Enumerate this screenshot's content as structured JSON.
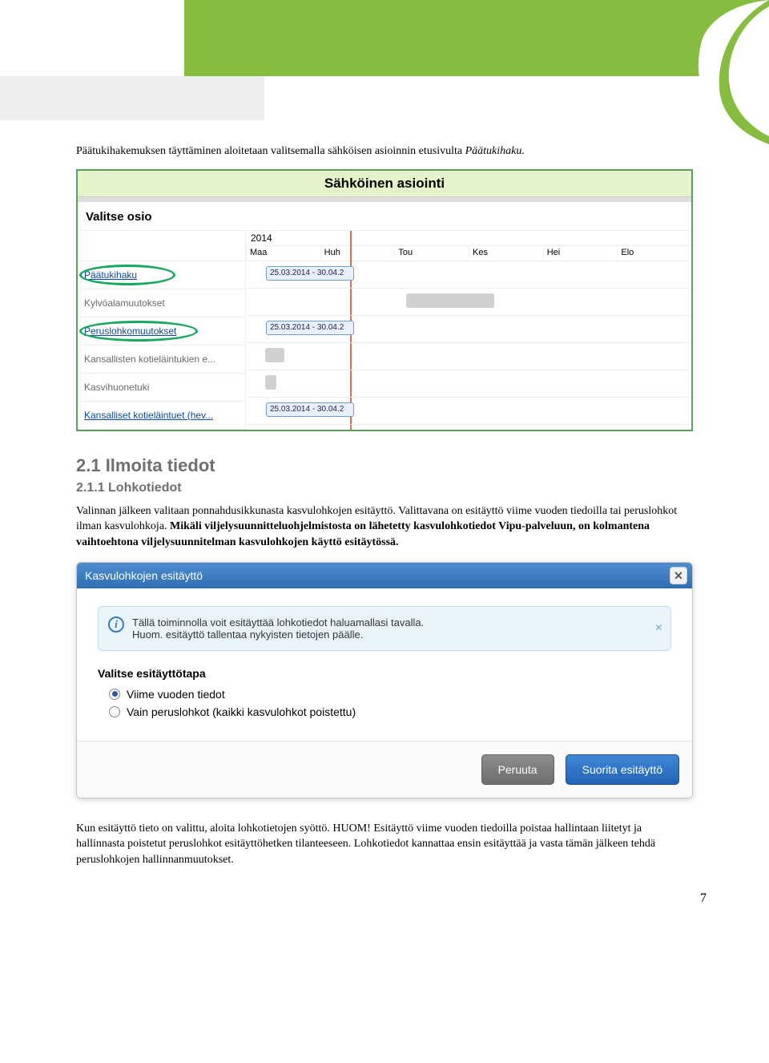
{
  "intro": "Päätukihakemuksen täyttäminen aloitetaan valitsemalla sähköisen asioinnin etusivulta ",
  "intro_em": "Päätukihaku.",
  "fig1": {
    "header": "Sähköinen asiointi",
    "select_label": "Valitse osio",
    "year": "2014",
    "months": [
      "Maa",
      "Huh",
      "Tou",
      "Kes",
      "Hei",
      "Elo"
    ],
    "rows": [
      {
        "label": "Päätukihaku",
        "link": true,
        "circled": true,
        "bar_date": "25.03.2014 - 30.04.2"
      },
      {
        "label": "Kylvöalamuutokset"
      },
      {
        "label": "Peruslohkomuutokset",
        "link": true,
        "circled": true,
        "bar_date": "25.03.2014 - 30.04.2"
      },
      {
        "label": "Kansallisten kotieläintukien e..."
      },
      {
        "label": "Kasvihuonetuki"
      },
      {
        "label": "Kansalliset kotieläintuet (hev...",
        "link": true,
        "bar_date": "25.03.2014 - 30.04.2"
      }
    ]
  },
  "h2": "2.1 Ilmoita tiedot",
  "h3": "2.1.1 Lohkotiedot",
  "para1": "Valinnan jälkeen valitaan ponnahdusikkunasta kasvulohkojen esitäyttö. Valittavana on esitäyttö viime vuoden tiedoilla tai peruslohkot ilman kasvulohkoja. ",
  "para1_bold": "Mikäli viljelysuunnitteluohjelmistosta on lähetetty kasvulohkotiedot Vipu-palveluun, on kolmantena vaihtoehtona viljelysuunnitelman kasvulohkojen käyttö esitäytössä.",
  "fig2": {
    "title": "Kasvulohkojen esitäyttö",
    "info_line1": "Tällä toiminnolla voit esitäyttää lohkotiedot haluamallasi tavalla.",
    "info_line2": "Huom. esitäyttö tallentaa nykyisten tietojen päälle.",
    "choose_label": "Valitse esitäyttötapa",
    "opt1": "Viime vuoden tiedot",
    "opt2": "Vain peruslohkot (kaikki kasvulohkot poistettu)",
    "cancel": "Peruuta",
    "submit": "Suorita esitäyttö"
  },
  "para2": "Kun esitäyttö tieto on valittu, aloita lohkotietojen syöttö. HUOM! Esitäyttö viime vuoden tiedoilla poistaa hallintaan liitetyt ja hallinnasta poistetut peruslohkot esitäyttöhetken tilanteeseen. Lohkotiedot kannattaa ensin esitäyttää ja vasta tämän jälkeen tehdä peruslohkojen hallinnanmuutokset.",
  "pagenum": "7"
}
